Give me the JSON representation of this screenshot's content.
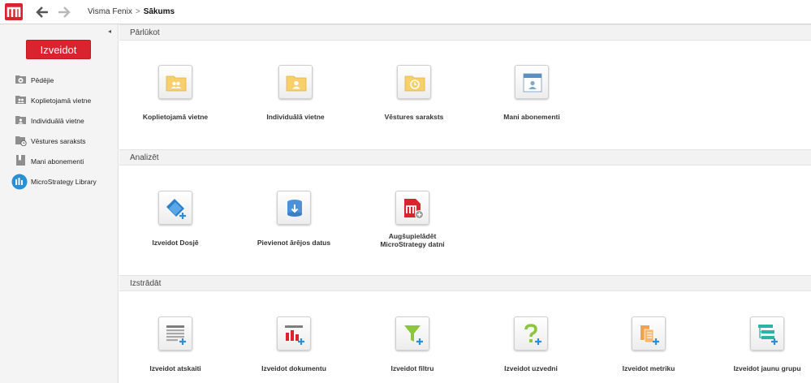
{
  "topbar": {
    "logo_icon": "microstrategy-logo-icon",
    "back_icon": "arrow-left-icon",
    "forward_icon": "arrow-right-icon",
    "breadcrumb": {
      "root": "Visma Fenix",
      "separator": ">",
      "current": "Sākums"
    }
  },
  "sidebar": {
    "collapse_glyph": "◂",
    "create_label": "Izveidot",
    "items": [
      {
        "label": "Pēdējie",
        "icon": "recent-icon"
      },
      {
        "label": "Koplietojamā vietne",
        "icon": "shared-folder-icon"
      },
      {
        "label": "Individuālā vietne",
        "icon": "personal-folder-icon"
      },
      {
        "label": "Vēstures saraksts",
        "icon": "history-list-icon"
      },
      {
        "label": "Mani abonementi",
        "icon": "subscriptions-icon"
      },
      {
        "label": "MicroStrategy Library",
        "icon": "library-icon"
      }
    ]
  },
  "sections": {
    "browse": {
      "title": "Pārlūkot",
      "tiles": [
        {
          "label": "Koplietojamā vietne",
          "icon": "shared-folder-icon"
        },
        {
          "label": "Individuālā vietne",
          "icon": "personal-folder-icon"
        },
        {
          "label": "Vēstures saraksts",
          "icon": "history-folder-icon"
        },
        {
          "label": "Mani abonementi",
          "icon": "subscriptions-icon"
        }
      ]
    },
    "analyze": {
      "title": "Analizēt",
      "tiles": [
        {
          "label": "Izveidot Dosjē",
          "icon": "create-dossier-icon"
        },
        {
          "label": "Pievienot ārējos datus",
          "icon": "add-external-data-icon"
        },
        {
          "label_line1": "Augšupielādēt",
          "label_line2": "MicroStrategy datni",
          "icon": "upload-mstr-file-icon"
        }
      ]
    },
    "develop": {
      "title": "Izstrādāt",
      "tiles": [
        {
          "label": "Izveidot atskaiti",
          "icon": "create-report-icon"
        },
        {
          "label": "Izveidot dokumentu",
          "icon": "create-document-icon"
        },
        {
          "label": "Izveidot filtru",
          "icon": "create-filter-icon"
        },
        {
          "label": "Izveidot uzvedni",
          "icon": "create-prompt-icon"
        },
        {
          "label": "Izveidot metriku",
          "icon": "create-metric-icon"
        },
        {
          "label": "Izveidot jaunu grupu",
          "icon": "create-group-icon"
        }
      ]
    }
  },
  "colors": {
    "brand_red": "#d9232e",
    "folder_yellow": "#f7cf6b",
    "accent_blue": "#2b8fd6"
  }
}
